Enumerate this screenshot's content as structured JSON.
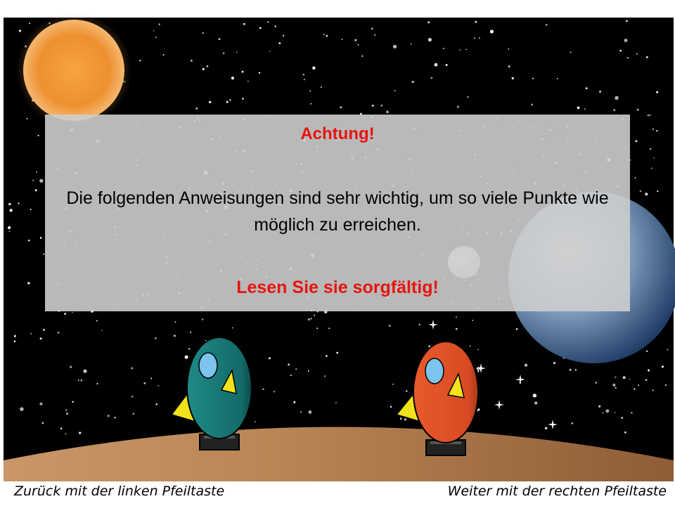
{
  "notice": {
    "heading": "Achtung!",
    "body": "Die folgenden Anweisungen sind sehr wichtig, um so viele Punkte wie möglich zu erreichen.",
    "emphasis": "Lesen Sie sie sorgfältig!"
  },
  "navigation": {
    "back_hint": "Zurück mit der linken Pfeiltaste",
    "next_hint": "Weiter mit der rechten Pfeiltaste"
  },
  "colors": {
    "space": "#000000",
    "sun": "#f2a040",
    "planet_blue": "#4a6f9a",
    "ground": "#b07a4a",
    "rocket_left": "#1a7a78",
    "rocket_right": "#e0542a",
    "warning_text": "#e8140f"
  },
  "icons": [
    "sun-icon",
    "planet-icon",
    "moon-icon",
    "rocket-left-icon",
    "rocket-right-icon"
  ]
}
